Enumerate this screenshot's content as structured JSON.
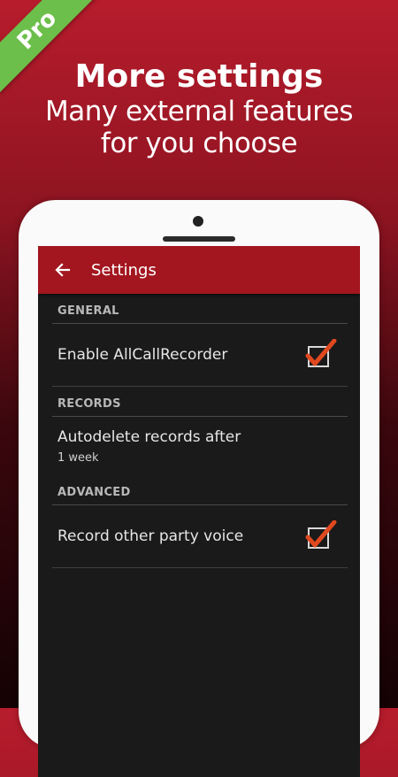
{
  "ribbon": {
    "label": "Pro"
  },
  "headline": {
    "title": "More settings",
    "subtitle_line1": "Many external features",
    "subtitle_line2": "for you choose"
  },
  "app": {
    "title": "Settings",
    "back_icon": "arrow-back-icon",
    "accent_color": "#a3161f",
    "check_color": "#e0481f"
  },
  "sections": {
    "general": {
      "header": "GENERAL",
      "enable_label": "Enable AllCallRecorder",
      "enable_checked": true
    },
    "records": {
      "header": "RECORDS",
      "autodelete_label": "Autodelete records after",
      "autodelete_value": "1 week"
    },
    "advanced": {
      "header": "ADVANCED",
      "record_other_label": "Record other party voice",
      "record_other_checked": true
    }
  }
}
